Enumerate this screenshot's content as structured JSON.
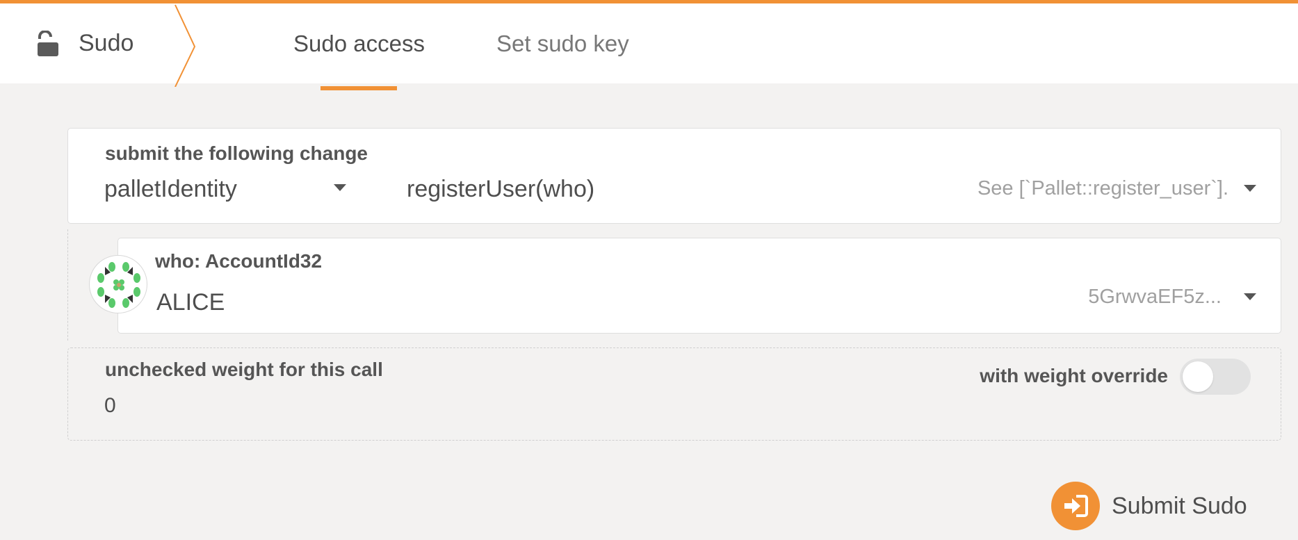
{
  "colors": {
    "accent": "#f19135",
    "background": "#f3f2f1",
    "text": "#4e4e4e"
  },
  "header": {
    "brand_icon": "unlock-icon",
    "brand_label": "Sudo",
    "tabs": [
      {
        "label": "Sudo access",
        "active": true
      },
      {
        "label": "Set sudo key",
        "active": false
      }
    ]
  },
  "call": {
    "heading": "submit the following change",
    "section": "palletIdentity",
    "method": "registerUser(who)",
    "description": "See [`Pallet::register_user`]."
  },
  "param": {
    "label": "who: AccountId32",
    "account_name": "ALICE",
    "address_short": "5GrwvaEF5z..."
  },
  "weight": {
    "label": "unchecked weight for this call",
    "value": "0",
    "override_label": "with weight override",
    "override_enabled": false
  },
  "submit": {
    "label": "Submit Sudo",
    "icon": "sign-in-icon"
  }
}
